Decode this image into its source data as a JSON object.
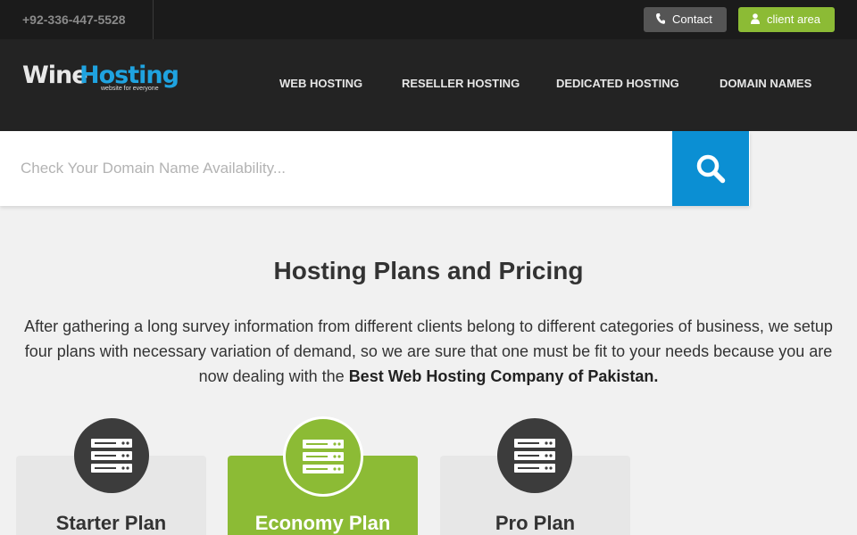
{
  "topbar": {
    "phone": "+92-336-447-5528",
    "contact_label": "Contact",
    "client_label": "client area"
  },
  "logo": {
    "part1": "Wine",
    "part2": "Hosting",
    "tagline": "website for everyone"
  },
  "nav": {
    "items": [
      "WEB HOSTING",
      "RESELLER HOSTING",
      "DEDICATED HOSTING",
      "DOMAIN NAMES"
    ]
  },
  "domain_search": {
    "placeholder": "Check Your Domain Name Availability...",
    "value": ""
  },
  "pricing": {
    "title": "Hosting Plans and Pricing",
    "intro": "After gathering a long survey information from different clients belong to different categories of business, we setup four plans with necessary variation of demand, so we are sure that one must be fit to your needs because you are now dealing with the ",
    "intro_bold": "Best Web Hosting Company of Pakistan.",
    "plans": [
      {
        "name": "Starter Plan",
        "icon": "server-icon"
      },
      {
        "name": "Economy Plan",
        "icon": "server-icon"
      },
      {
        "name": "Pro Plan",
        "icon": "server-icon"
      }
    ]
  },
  "colors": {
    "accent_green": "#8cbb35",
    "accent_blue": "#0b8fd3",
    "topbar_bg": "#1b1b1b",
    "nav_bg": "#232323"
  }
}
